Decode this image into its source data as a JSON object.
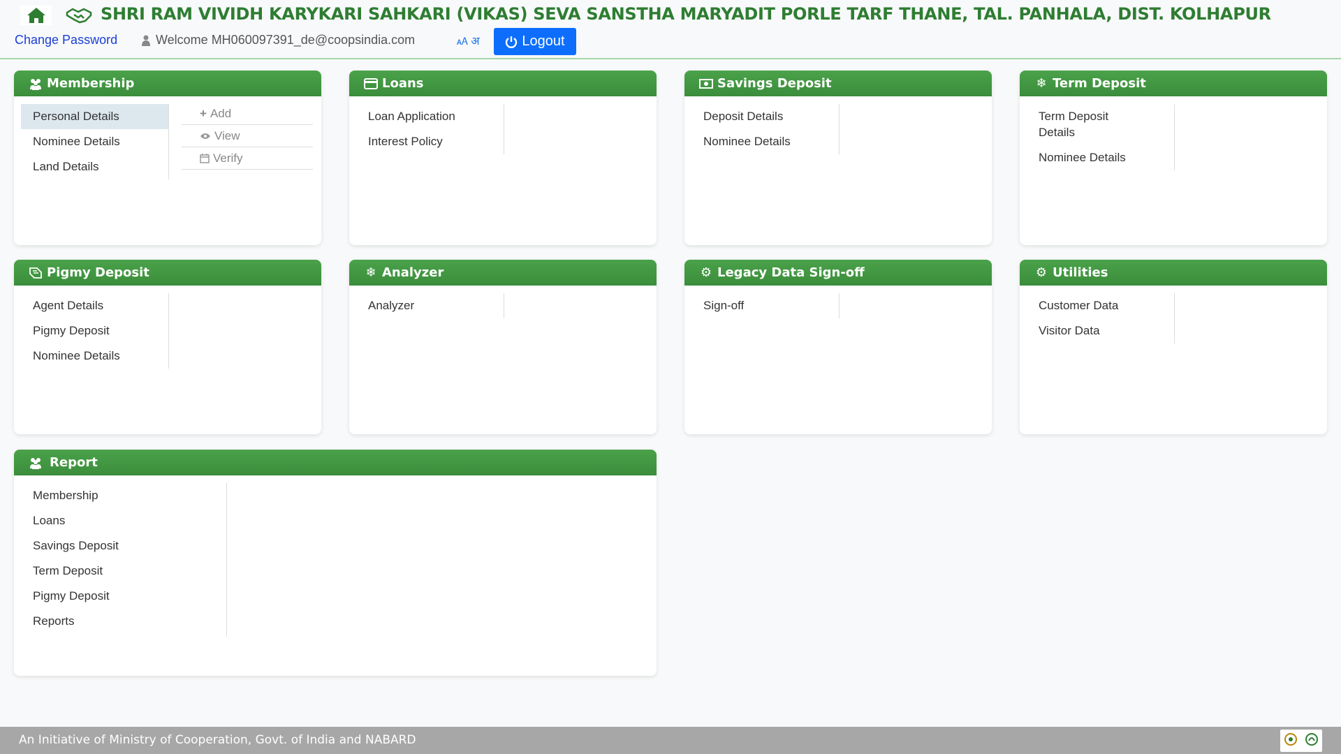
{
  "header": {
    "org_title": "SHRI RAM VIVIDH KARYKARI SAHKARI (VIKAS) SEVA SANSTHA MARYADIT PORLE TARF THANE, TAL. PANHALA, DIST. KOLHAPUR",
    "change_password": "Change Password",
    "welcome": "Welcome MH060097391_de@coopsindia.com",
    "language_toggle": "अ",
    "logout": "Logout"
  },
  "cards": {
    "membership": {
      "title": "Membership",
      "items": [
        "Personal Details",
        "Nominee Details",
        "Land Details"
      ],
      "subitems": [
        "Add",
        "View",
        "Verify"
      ]
    },
    "loans": {
      "title": "Loans",
      "items": [
        "Loan Application",
        "Interest Policy"
      ]
    },
    "savings": {
      "title": "Savings Deposit",
      "items": [
        "Deposit Details",
        "Nominee Details"
      ]
    },
    "term": {
      "title": "Term Deposit",
      "items": [
        "Term Deposit Details",
        "Nominee Details"
      ]
    },
    "pigmy": {
      "title": "Pigmy Deposit",
      "items": [
        "Agent Details",
        "Pigmy Deposit",
        "Nominee Details"
      ]
    },
    "analyzer": {
      "title": "Analyzer",
      "items": [
        "Analyzer"
      ]
    },
    "legacy": {
      "title": "Legacy Data Sign-off",
      "items": [
        "Sign-off"
      ]
    },
    "utilities": {
      "title": "Utilities",
      "items": [
        "Customer Data",
        "Visitor Data"
      ]
    },
    "report": {
      "title": "Report",
      "items": [
        "Membership",
        "Loans",
        "Savings Deposit",
        "Term Deposit",
        "Pigmy Deposit",
        "Reports"
      ]
    }
  },
  "footer": {
    "text": "An Initiative of Ministry of Cooperation, Govt. of India and NABARD"
  },
  "colors": {
    "brand_green": "#2e7d32",
    "card_header_green": "#43a047",
    "logout_blue": "#0d6efd",
    "link_blue": "#1a3fd4",
    "footer_gray": "#a7a7a7"
  }
}
